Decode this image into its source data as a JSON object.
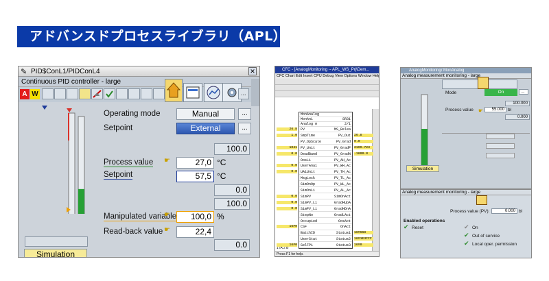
{
  "banner": {
    "title": "アドバンスドプロセスライブラリ（APL）"
  },
  "panel1": {
    "window_title": "PID$ConL1/PIDConL4",
    "subtitle": "Continuous PID controller - large",
    "alarm_a": "A",
    "alarm_w": "W",
    "close": "✕",
    "operating_mode_label": "Operating mode",
    "operating_mode_value": "Manual",
    "setpoint_label": "Setpoint",
    "setpoint_mode_value": "External",
    "dots": "...",
    "range_high_1": "100.0",
    "process_value_label": "Process value",
    "process_value": "27,0",
    "process_value_unit": "°C",
    "setpoint_value_label": "Setpoint",
    "setpoint_value": "57,5",
    "setpoint_unit": "°C",
    "range_low_1": "0.0",
    "range_high_2": "100.0",
    "manipulated_label": "Manipulated variable",
    "manipulated_value": "100,0",
    "manipulated_unit": "%",
    "readback_label": "Read-back value",
    "readback_value": "22,4",
    "range_low_2": "0.0",
    "simulation_label": "Simulation",
    "bar_fill_percent": 27
  },
  "panel2": {
    "window_title": "CFC - [AnalogMonitoring -- APL_WS_Prj\\Dem...",
    "menu": "CFC Chart  Edit  Insert  CPU  Debug  View  Options  Window  Help",
    "block_name": "MonAnalog",
    "block_type": "MonAnL",
    "block_cell": "Analog A",
    "block_ref": "SR31",
    "block_ref2": "2/1",
    "rows": [
      {
        "in": "PV",
        "out": "MS_Relea"
      },
      {
        "in": "SmpTime",
        "out": "PV_Out"
      },
      {
        "in": "PV_OpScale",
        "out": "PV_Grad"
      },
      {
        "in": "PV_Unit",
        "out": "PV_GradP"
      },
      {
        "in": "DeadBand",
        "out": "PV_GradN"
      },
      {
        "in": "OosLi",
        "out": "PV_AH_Ac"
      },
      {
        "in": "UserAna1",
        "out": "PV_WH_Ac"
      },
      {
        "in": "UA1Unit",
        "out": "PV_TH_Ac"
      },
      {
        "in": "MsgLock",
        "out": "PV_TL_Ac"
      },
      {
        "in": "SimOnOp",
        "out": "PV_WL_Ac"
      },
      {
        "in": "SimOnLi",
        "out": "PV_AL_Ac"
      },
      {
        "in": "SimPV",
        "out": "SimOnAct"
      },
      {
        "in": "SimPV_Li",
        "out": "GradHUpA"
      },
      {
        "in": "SimPV_Li",
        "out": "GradHDnA"
      },
      {
        "in": "StepNo",
        "out": "GradLAct"
      },
      {
        "in": "Occupied",
        "out": "OosAct"
      },
      {
        "in": "CSF",
        "out": "OnAct"
      },
      {
        "in": "BatchID",
        "out": "Status1"
      },
      {
        "in": "UserStat",
        "out": "Status2"
      },
      {
        "in": "SelFP1",
        "out": "Status3"
      }
    ],
    "left_values": [
      "26.8",
      "1.0",
      "",
      "1041",
      "0.0",
      "",
      "0.0",
      "0.0",
      "",
      "",
      "",
      "0.0",
      "0.0",
      "0.0",
      "",
      "",
      "16#0",
      "",
      "",
      "16#0"
    ],
    "right_values": [
      "",
      "26.8",
      "0.0",
      "2199.723",
      "-1800.0",
      "",
      "",
      "",
      "",
      "",
      "",
      "",
      "",
      "",
      "",
      "",
      "",
      "16#668",
      "16#1E3FFF",
      "16#0"
    ],
    "tab_label": "1  /A  2  B",
    "status": "Press F1 for help."
  },
  "panel3": {
    "window_title": "AnalogMonitoring/ MonAnalog",
    "subtitle": "Analog measurement monitoring - large",
    "mode_label": "Mode",
    "mode_value": "On",
    "range_high": "100.000",
    "pv_label": "Process value",
    "pv_value": "55.000",
    "pv_unit": "bl",
    "range_low": "0.000",
    "simulation": "Simulation",
    "bottom_title": "Analog measurement monitoring - large",
    "pv2_label": "Process value (PV):",
    "pv2_value": "0.000",
    "pv2_unit": "bl",
    "enabled_ops": "Enabled operations",
    "ops": [
      "Reset",
      "On",
      "Out of service",
      "Local oper. permission"
    ]
  },
  "colors": {
    "banner": "#0b3aa8",
    "alarm_red": "#e31b1b",
    "warn_yellow": "#f5e000",
    "bar_green": "#27a035",
    "on_green": "#39b54a"
  }
}
